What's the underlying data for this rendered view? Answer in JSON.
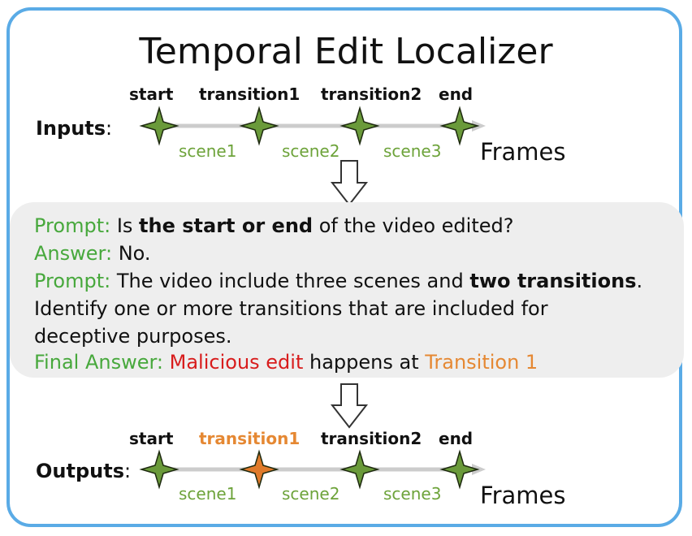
{
  "title": "Temporal Edit Localizer",
  "inputs": {
    "label": "Inputs",
    "colon": ":",
    "markers": [
      "start",
      "transition1",
      "transition2",
      "end"
    ],
    "scenes": [
      "scene1",
      "scene2",
      "scene3"
    ],
    "axis_label": "Frames"
  },
  "dialogue": {
    "q1_tag": "Prompt:",
    "q1_pre": "Is ",
    "q1_bold": "the start or end",
    "q1_post": " of the video edited?",
    "a1_tag": "Answer:",
    "a1_text": "No.",
    "q2_tag": "Prompt:",
    "q2_pre": "The video include three scenes and ",
    "q2_bold": "two transitions",
    "q2_post": ".",
    "q2_line2": "Identify one or more transitions that are included for",
    "q2_line3": "deceptive purposes.",
    "final_tag": "Final Answer:",
    "final_red": "Malicious edit",
    "final_mid": " happens at ",
    "final_orange": "Transition 1"
  },
  "outputs": {
    "label": "Outputs",
    "colon": ":",
    "markers": [
      "start",
      "transition1",
      "transition2",
      "end"
    ],
    "highlight_index": 1,
    "scenes": [
      "scene1",
      "scene2",
      "scene3"
    ],
    "axis_label": "Frames"
  },
  "colors": {
    "border": "#5aabe6",
    "marker_green": "#6a9a3a",
    "marker_orange": "#e07a2a",
    "scene_text": "#6da33a",
    "tag_green": "#47a83c",
    "malicious_red": "#d81c1c",
    "transition_orange": "#e58833"
  }
}
